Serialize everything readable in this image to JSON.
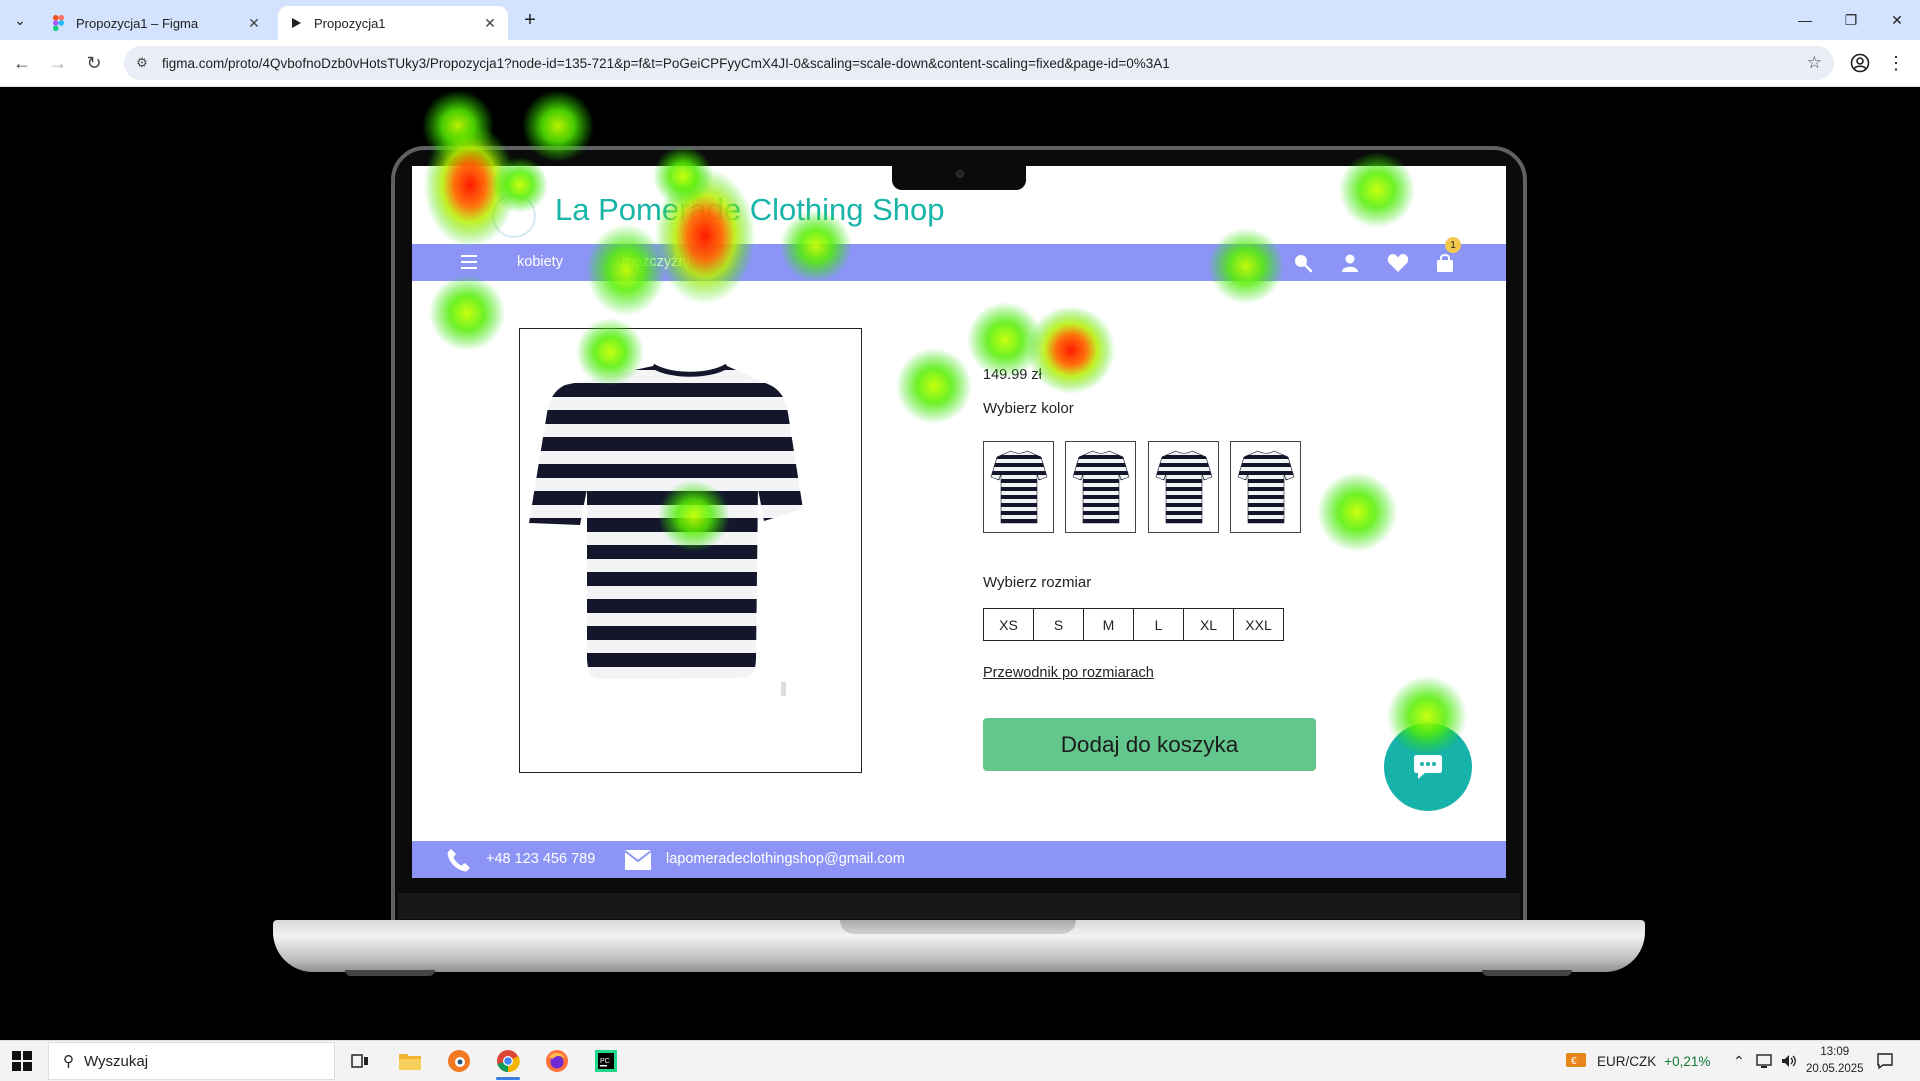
{
  "browser": {
    "tabs": [
      {
        "title": "Propozycja1 – Figma",
        "icon": "figma-icon"
      },
      {
        "title": "Propozycja1",
        "icon": "play-icon",
        "active": true
      }
    ],
    "url": "figma.com/proto/4QvbofnoDzb0vHotsTUky3/Propozycja1?node-id=135-721&p=f&t=PoGeiCPFyyCmX4JI-0&scaling=scale-down&content-scaling=fixed&page-id=0%3A1"
  },
  "site": {
    "brand": "La Pomerade Clothing Shop",
    "nav": {
      "link1": "kobiety",
      "link2": "mężczyźni"
    },
    "cart_count": "1",
    "product": {
      "price": "149.99 zł",
      "color_label": "Wybierz kolor",
      "size_label": "Wybierz rozmiar",
      "sizes": [
        "XS",
        "S",
        "M",
        "L",
        "XL",
        "XXL"
      ],
      "size_guide": "Przewodnik po rozmiarach",
      "add_to_cart": "Dodaj do koszyka"
    },
    "footer": {
      "phone": "+48 123 456 789",
      "email": "lapomeradeclothingshop@gmail.com"
    },
    "colors": {
      "nav": "#8c95f6",
      "brand": "#19b5a8",
      "cta": "#63c68c",
      "chat": "#17b2a9"
    }
  },
  "taskbar": {
    "search_placeholder": "Wyszukaj",
    "currency": "EUR/CZK",
    "currency_change": "+0,21%",
    "time": "13:09",
    "date": "20.05.2025"
  }
}
